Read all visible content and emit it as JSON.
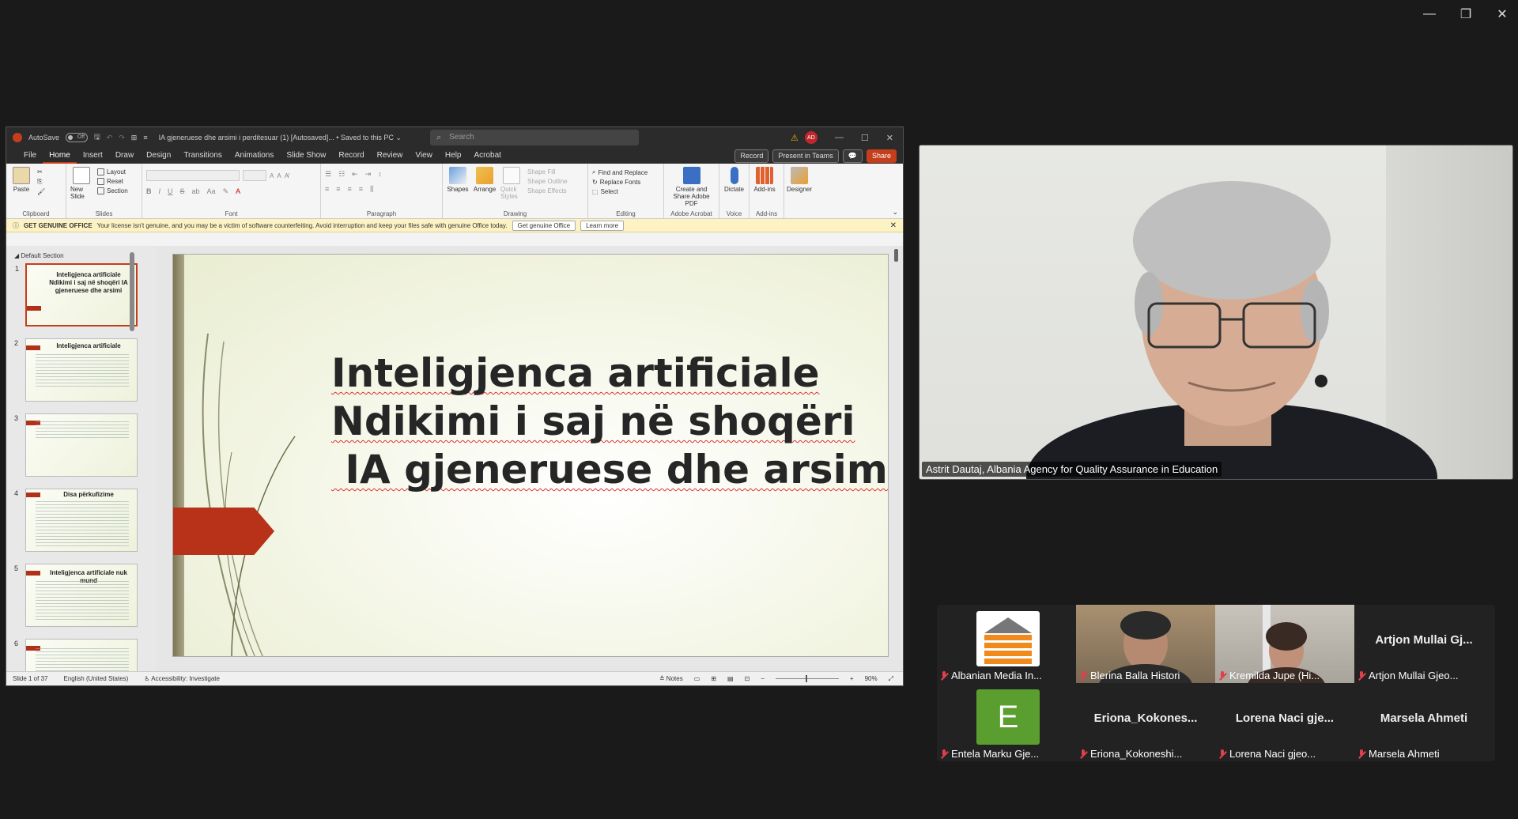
{
  "window": {
    "minimize_icon": "minimize-icon",
    "restore_icon": "restore-icon",
    "close_icon": "close-icon"
  },
  "ppt": {
    "autosave": "AutoSave",
    "autosave_state": "Off",
    "doc_title": "IA gjeneruese dhe arsimi i perditesuar (1) [Autosaved]... • Saved to this PC ⌄",
    "search_placeholder": "Search",
    "user_initials": "AD",
    "menu": [
      "File",
      "Home",
      "Insert",
      "Draw",
      "Design",
      "Transitions",
      "Animations",
      "Slide Show",
      "Record",
      "Review",
      "View",
      "Help",
      "Acrobat"
    ],
    "active_tab": "Home",
    "record_btn": "Record",
    "present_btn": "Present in Teams",
    "share_btn": "Share",
    "ribbon": {
      "paste": "Paste",
      "clipboard": "Clipboard",
      "new_slide": "New Slide",
      "layout": "Layout",
      "reset": "Reset",
      "section": "Section",
      "slides": "Slides",
      "font": "Font",
      "paragraph": "Paragraph",
      "shapes": "Shapes",
      "arrange": "Arrange",
      "quick_styles": "Quick Styles",
      "shape_fill": "Shape Fill",
      "shape_outline": "Shape Outline",
      "shape_effects": "Shape Effects",
      "drawing": "Drawing",
      "find_replace": "Find and Replace",
      "replace_fonts": "Replace Fonts",
      "select": "Select",
      "editing": "Editing",
      "create_share_pdf": "Create and Share Adobe PDF",
      "adobe_acrobat": "Adobe Acrobat",
      "dictate": "Dictate",
      "voice": "Voice",
      "addins": "Add-ins",
      "addins_group": "Add-ins",
      "designer": "Designer"
    },
    "license": {
      "label": "GET GENUINE OFFICE",
      "message": "Your license isn't genuine, and you may be a victim of software counterfeiting. Avoid interruption and keep your files safe with genuine Office today.",
      "btn_get": "Get genuine Office",
      "btn_learn": "Learn more"
    },
    "section_name": "Default Section",
    "thumbs": [
      {
        "num": "1",
        "title": "Inteligjenca artificiale Ndikimi i saj në shoqëri IA gjeneruese dhe arsimi"
      },
      {
        "num": "2",
        "title": "Inteligjenca artificiale"
      },
      {
        "num": "3",
        "title": ""
      },
      {
        "num": "4",
        "title": "Disa përkufizime"
      },
      {
        "num": "5",
        "title": "Inteligjenca artificiale nuk mund"
      },
      {
        "num": "6",
        "title": ""
      }
    ],
    "slide_title_lines": [
      "Inteligjenca artificiale",
      "Ndikimi i saj në shoqëri",
      " IA gjeneruese dhe arsimi"
    ],
    "status": {
      "slide_of": "Slide 1 of 37",
      "language": "English (United States)",
      "accessibility": "Accessibility: Investigate",
      "notes": "Notes",
      "zoom": "90%"
    }
  },
  "video": {
    "name": "Astrit Dautaj, Albania Agency for Quality Assurance in Education"
  },
  "participants": [
    {
      "name": "Albanian Media In...",
      "type": "logo"
    },
    {
      "name": "Blerina Balla Histori",
      "type": "video"
    },
    {
      "name": "Kremilda Jupe (Hi...",
      "type": "video"
    },
    {
      "name": "Artjon Mullai Gjeo...",
      "type": "text",
      "big": "Artjon Mullai Gj..."
    },
    {
      "name": "Entela Marku Gje...",
      "type": "letter",
      "letter": "E"
    },
    {
      "name": "Eriona_Kokoneshi...",
      "type": "text",
      "big": "Eriona_Kokones..."
    },
    {
      "name": "Lorena Naci gjeo...",
      "type": "text",
      "big": "Lorena Naci gje..."
    },
    {
      "name": "Marsela Ahmeti",
      "type": "text",
      "big": "Marsela Ahmeti"
    }
  ]
}
